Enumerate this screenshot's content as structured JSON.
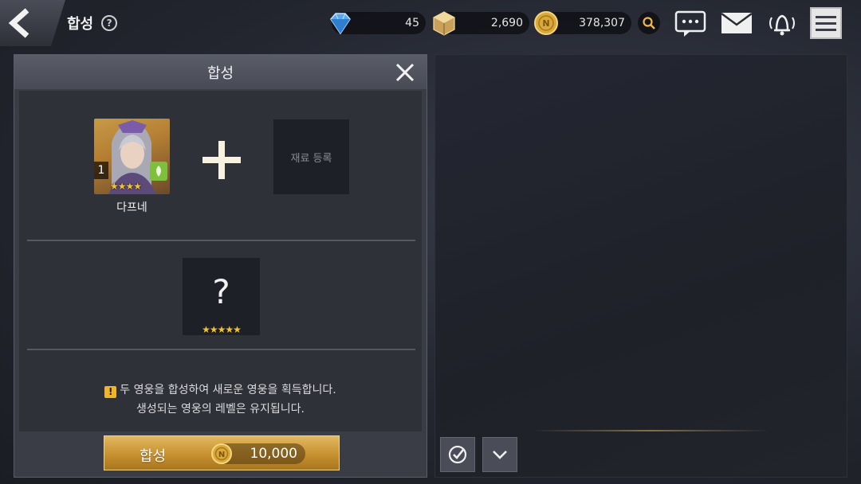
{
  "header": {
    "title": "합성",
    "help": "?"
  },
  "currencies": [
    {
      "name": "diamond",
      "value": "45"
    },
    {
      "name": "material-cube",
      "value": "2,690"
    },
    {
      "name": "gold",
      "value": "378,307"
    }
  ],
  "panel": {
    "title": "합성",
    "hero": {
      "name": "다프네",
      "level": "1",
      "stars": "★★★★"
    },
    "material_slot_label": "재료 등록",
    "result": {
      "symbol": "?",
      "stars": "★★★★★"
    },
    "info_line1": "두 영웅을 합성하여 새로운 영웅을 획득합니다.",
    "info_line2": "생성되는 영웅의 레벨은 유지됩니다.",
    "warn_mark": "!",
    "synth_button": {
      "label": "합성",
      "cost": "10,000"
    }
  },
  "colors": {
    "accent_gold": "#c79130",
    "panel_bg": "#3a3c46",
    "star": "#f2c230"
  }
}
